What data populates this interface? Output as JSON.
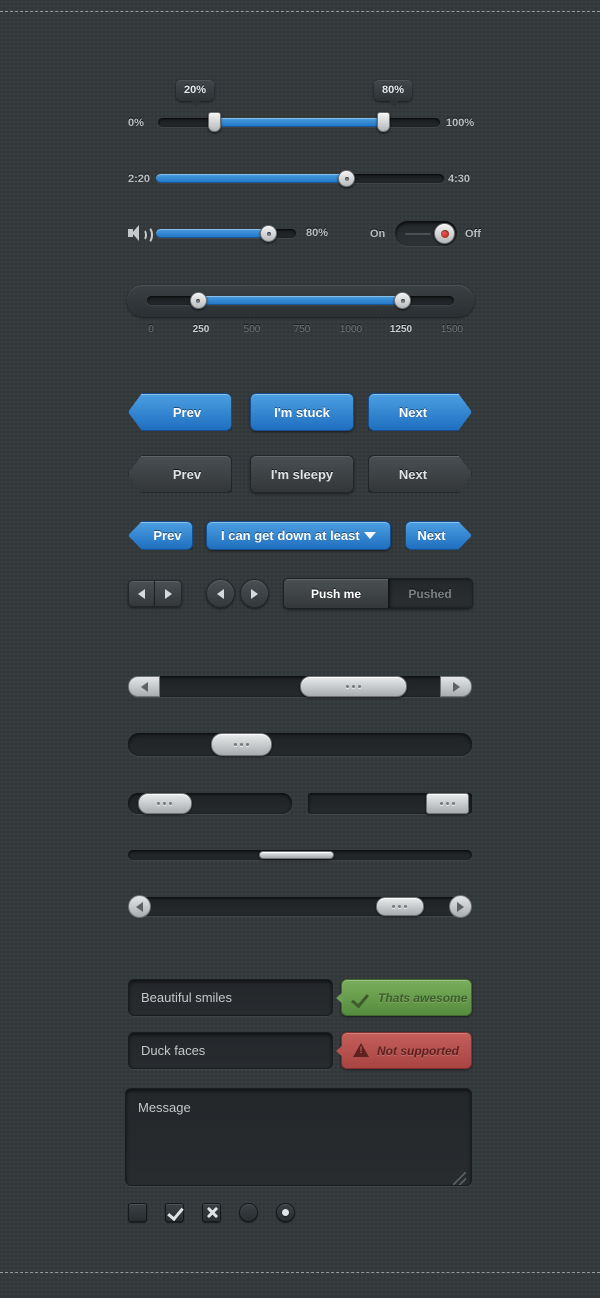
{
  "range_slider": {
    "min_label": "0%",
    "max_label": "100%",
    "low_tooltip": "20%",
    "high_tooltip": "80%",
    "low_value": 20,
    "high_value": 80
  },
  "time_slider": {
    "left_label": "2:20",
    "right_label": "4:30",
    "value_percent": 66
  },
  "volume_slider": {
    "icon": "speaker-icon",
    "value_label": "80%",
    "value_percent": 80
  },
  "toggle": {
    "on_label": "On",
    "off_label": "Off",
    "state": "off",
    "led_color": "#c8342c"
  },
  "tick_slider": {
    "ticks": [
      "0",
      "250",
      "500",
      "750",
      "1000",
      "1250",
      "1500"
    ],
    "active_ticks": [
      "250",
      "1250"
    ],
    "low_value": 250,
    "high_value": 1250,
    "min": 0,
    "max": 1500
  },
  "buttons": {
    "blue_row": [
      "Prev",
      "I'm stuck",
      "Next"
    ],
    "gray_row": [
      "Prev",
      "I'm sleepy",
      "Next"
    ],
    "dropdown_row": {
      "prev": "Prev",
      "select_value": "I can get down at least",
      "next": "Next",
      "caret": "chevron-down-icon"
    }
  },
  "small_controls": {
    "pair_left": "arrow-left-icon",
    "pair_right": "arrow-right-icon",
    "circle_left": "arrow-left-icon",
    "circle_right": "arrow-right-icon",
    "segmented": {
      "active": "Push me",
      "inactive": "Pushed"
    }
  },
  "scrollbars": {
    "grip": "grip-dots-icon",
    "bar1": {
      "thumb_left_percent": 50,
      "thumb_width_percent": 31,
      "has_arrows": true
    },
    "bar2": {
      "thumb_left_percent": 24,
      "thumb_width_percent": 18
    },
    "bar3_left": {
      "thumb_left_percent": 6,
      "thumb_width_percent": 33
    },
    "bar3_right": {
      "thumb_left_percent": 72,
      "thumb_width_percent": 26
    },
    "bar4_thin": {
      "thumb_left_percent": 38,
      "thumb_width_percent": 22
    },
    "bar5": {
      "thumb_left_percent": 72,
      "thumb_width_percent": 14,
      "has_round_arrows": true
    }
  },
  "forms": {
    "input_1": "Beautiful smiles",
    "input_2": "Duck faces",
    "textarea_placeholder": "Message",
    "callout_success": {
      "text": "Thats awesome",
      "icon": "check-icon",
      "color": "#6a9e4f"
    },
    "callout_error": {
      "text": "Not supported",
      "icon": "warning-icon",
      "color": "#b8504f"
    }
  },
  "choices": {
    "checkbox_empty": "checkbox-unchecked",
    "checkbox_checked": "checkbox-checked",
    "checkbox_x": "checkbox-x",
    "radio_empty": "radio-unchecked",
    "radio_selected": "radio-selected"
  }
}
